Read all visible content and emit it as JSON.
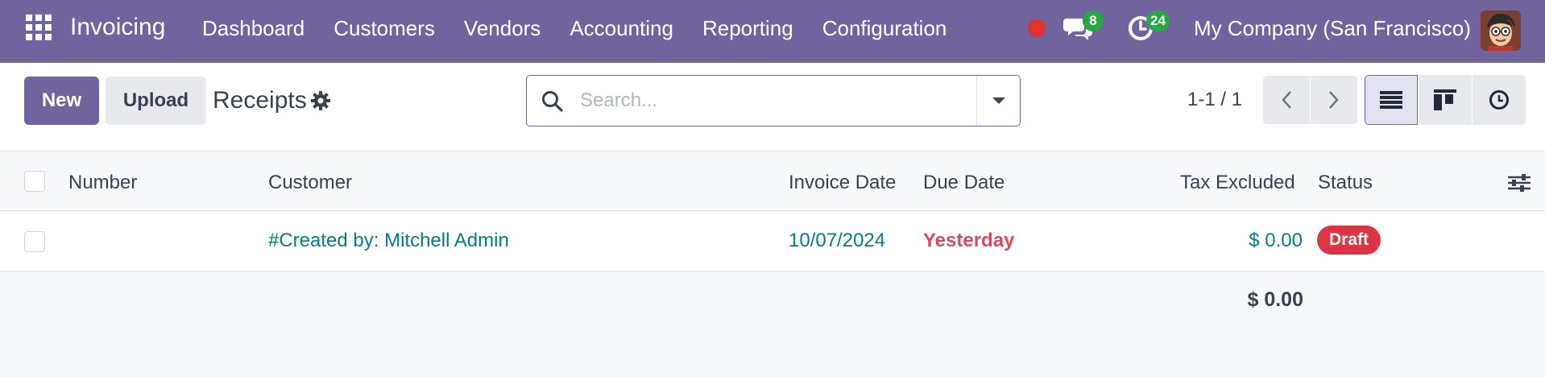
{
  "navbar": {
    "app_name": "Invoicing",
    "menu": [
      "Dashboard",
      "Customers",
      "Vendors",
      "Accounting",
      "Reporting",
      "Configuration"
    ],
    "messages_count": "8",
    "activities_count": "24",
    "company": "My Company (San Francisco)",
    "icons": [
      "apps-grid-icon",
      "record-dot-icon",
      "chat-icon",
      "activity-clock-icon",
      "avatar"
    ]
  },
  "control_panel": {
    "new_label": "New",
    "upload_label": "Upload",
    "title": "Receipts",
    "search_placeholder": "Search...",
    "pager": "1-1 / 1"
  },
  "list": {
    "columns": [
      "Number",
      "Customer",
      "Invoice Date",
      "Due Date",
      "Tax Excluded",
      "Status"
    ],
    "rows": [
      {
        "number": "",
        "customer": "#Created by: Mitchell Admin",
        "invoice_date": "10/07/2024",
        "due_date": "Yesterday",
        "tax_excluded": "$ 0.00",
        "status": "Draft"
      }
    ],
    "total": "$ 0.00"
  },
  "colors": {
    "brand": "#71639e",
    "link": "#017e84",
    "danger": "#d44c59",
    "badge_green": "#28a745",
    "status_draft": "#dc3545"
  }
}
